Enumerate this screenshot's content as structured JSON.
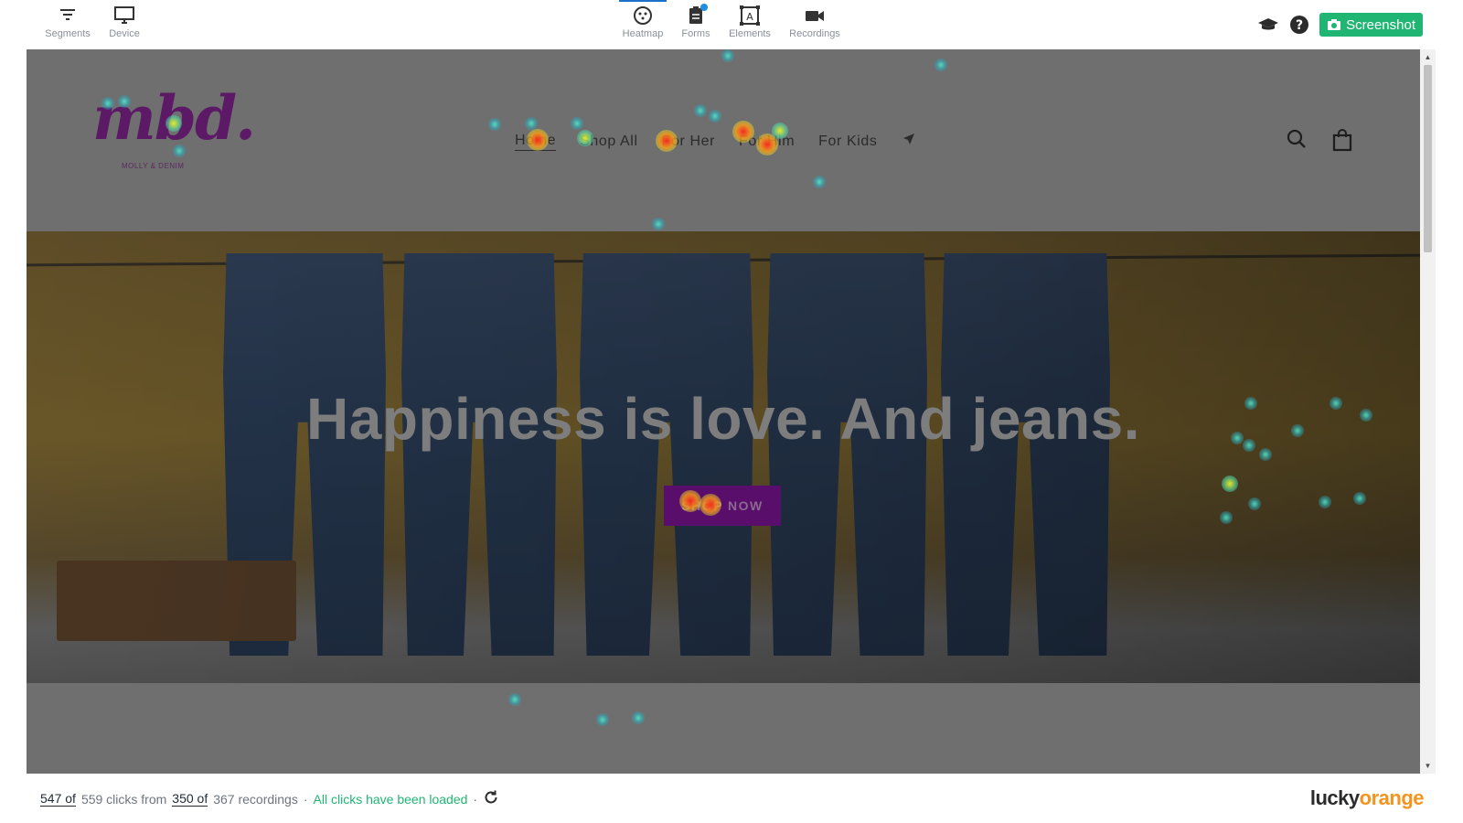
{
  "toolbar": {
    "left_tools": [
      {
        "label": "Segments",
        "icon": "filter-lines-icon"
      },
      {
        "label": "Device",
        "icon": "monitor-icon"
      }
    ],
    "center_tools": [
      {
        "label": "Heatmap",
        "icon": "heatmap-icon",
        "active": true
      },
      {
        "label": "Forms",
        "icon": "clipboard-icon",
        "badge": true
      },
      {
        "label": "Elements",
        "icon": "element-select-icon"
      },
      {
        "label": "Recordings",
        "icon": "video-camera-icon"
      }
    ],
    "screenshot_label": "Screenshot",
    "accent": "#21b573"
  },
  "site": {
    "logo_text": "mbd.",
    "logo_subtext": "MOLLY & DENIM",
    "nav": [
      "Home",
      "Shop All",
      "For Her",
      "For Him",
      "For Kids"
    ],
    "hero_headline": "Happiness is love. And jeans.",
    "hero_button": "SHOP NOW",
    "brand_color": "#5a0e6b"
  },
  "footer": {
    "clicks_shown": "547 of",
    "clicks_total": "559 clicks from",
    "recordings_shown": "350 of",
    "recordings_total": "367 recordings",
    "separator": "·",
    "status": "All clicks have been loaded",
    "brand_part1": "lucky",
    "brand_part2": "orange"
  }
}
